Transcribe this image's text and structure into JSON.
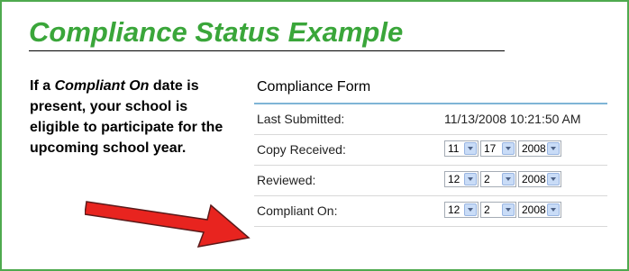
{
  "slide": {
    "title": "Compliance Status Example",
    "explanation": {
      "prefix": "If a ",
      "emphasis": "Compliant On",
      "suffix": " date is present, your school is eligible to participate for the upcoming school year."
    }
  },
  "form": {
    "header": "Compliance Form",
    "last_submitted": {
      "label": "Last Submitted:",
      "value": "11/13/2008 10:21:50 AM"
    },
    "copy_received": {
      "label": "Copy Received:",
      "month": "11",
      "day": "17",
      "year": "2008"
    },
    "reviewed": {
      "label": "Reviewed:",
      "month": "12",
      "day": "2",
      "year": "2008"
    },
    "compliant_on": {
      "label": "Compliant On:",
      "month": "12",
      "day": "2",
      "year": "2008"
    }
  },
  "colors": {
    "title_green": "#3aa63a",
    "border_green": "#4faa4f",
    "header_rule": "#7fb5d6",
    "arrow_red": "#e8241f"
  },
  "icons": {
    "dropdown": "chevron-down-icon",
    "pointer": "red-arrow-icon"
  }
}
